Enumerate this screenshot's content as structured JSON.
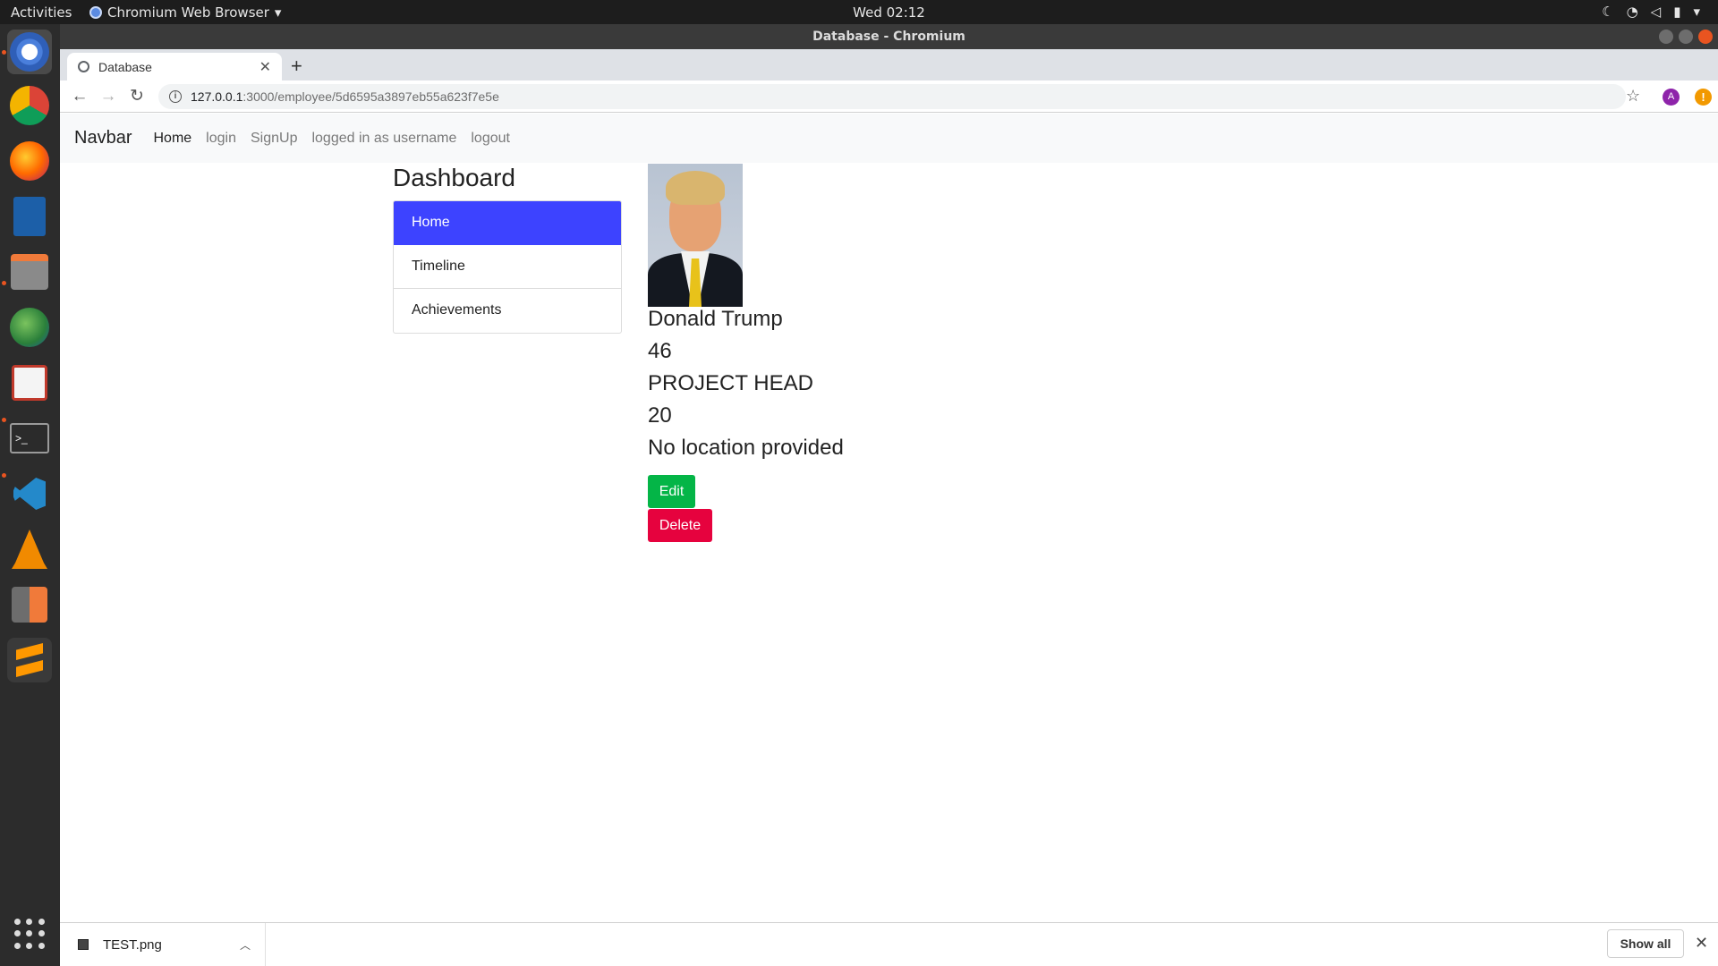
{
  "topbar": {
    "activities": "Activities",
    "app_name": "Chromium Web Browser",
    "app_menu_arrow": "▾",
    "clock": "Wed 02:12",
    "tray_icons": [
      "moon-icon",
      "wifi-icon",
      "volume-icon",
      "battery-icon",
      "chevron-down-icon"
    ]
  },
  "window": {
    "title": "Database - Chromium"
  },
  "browser": {
    "tab_title": "Database",
    "new_tab": "+",
    "url_host": "127.0.0.1",
    "url_path": ":3000/employee/5d6595a3897eb55a623f7e5e",
    "profile_initial": "A",
    "alert_symbol": "!"
  },
  "navbar": {
    "brand": "Navbar",
    "links": [
      "Home",
      "login",
      "SignUp",
      "logged in as username",
      "logout"
    ]
  },
  "dashboard": {
    "title": "Dashboard",
    "menu": [
      "Home",
      "Timeline",
      "Achievements"
    ],
    "active_item": "Home"
  },
  "employee": {
    "name": "Donald Trump",
    "age": "46",
    "role": "PROJECT HEAD",
    "experience": "20",
    "location": "No location provided"
  },
  "actions": {
    "edit": "Edit",
    "delete": "Delete"
  },
  "downloads": {
    "file": "TEST.png",
    "show_all": "Show all"
  },
  "colors": {
    "active_menu": "#3d43ff",
    "edit_button": "#04b547",
    "delete_button": "#e6023e",
    "dock_bg": "#2c2c2c",
    "topbar_bg": "#1d1d1d"
  }
}
